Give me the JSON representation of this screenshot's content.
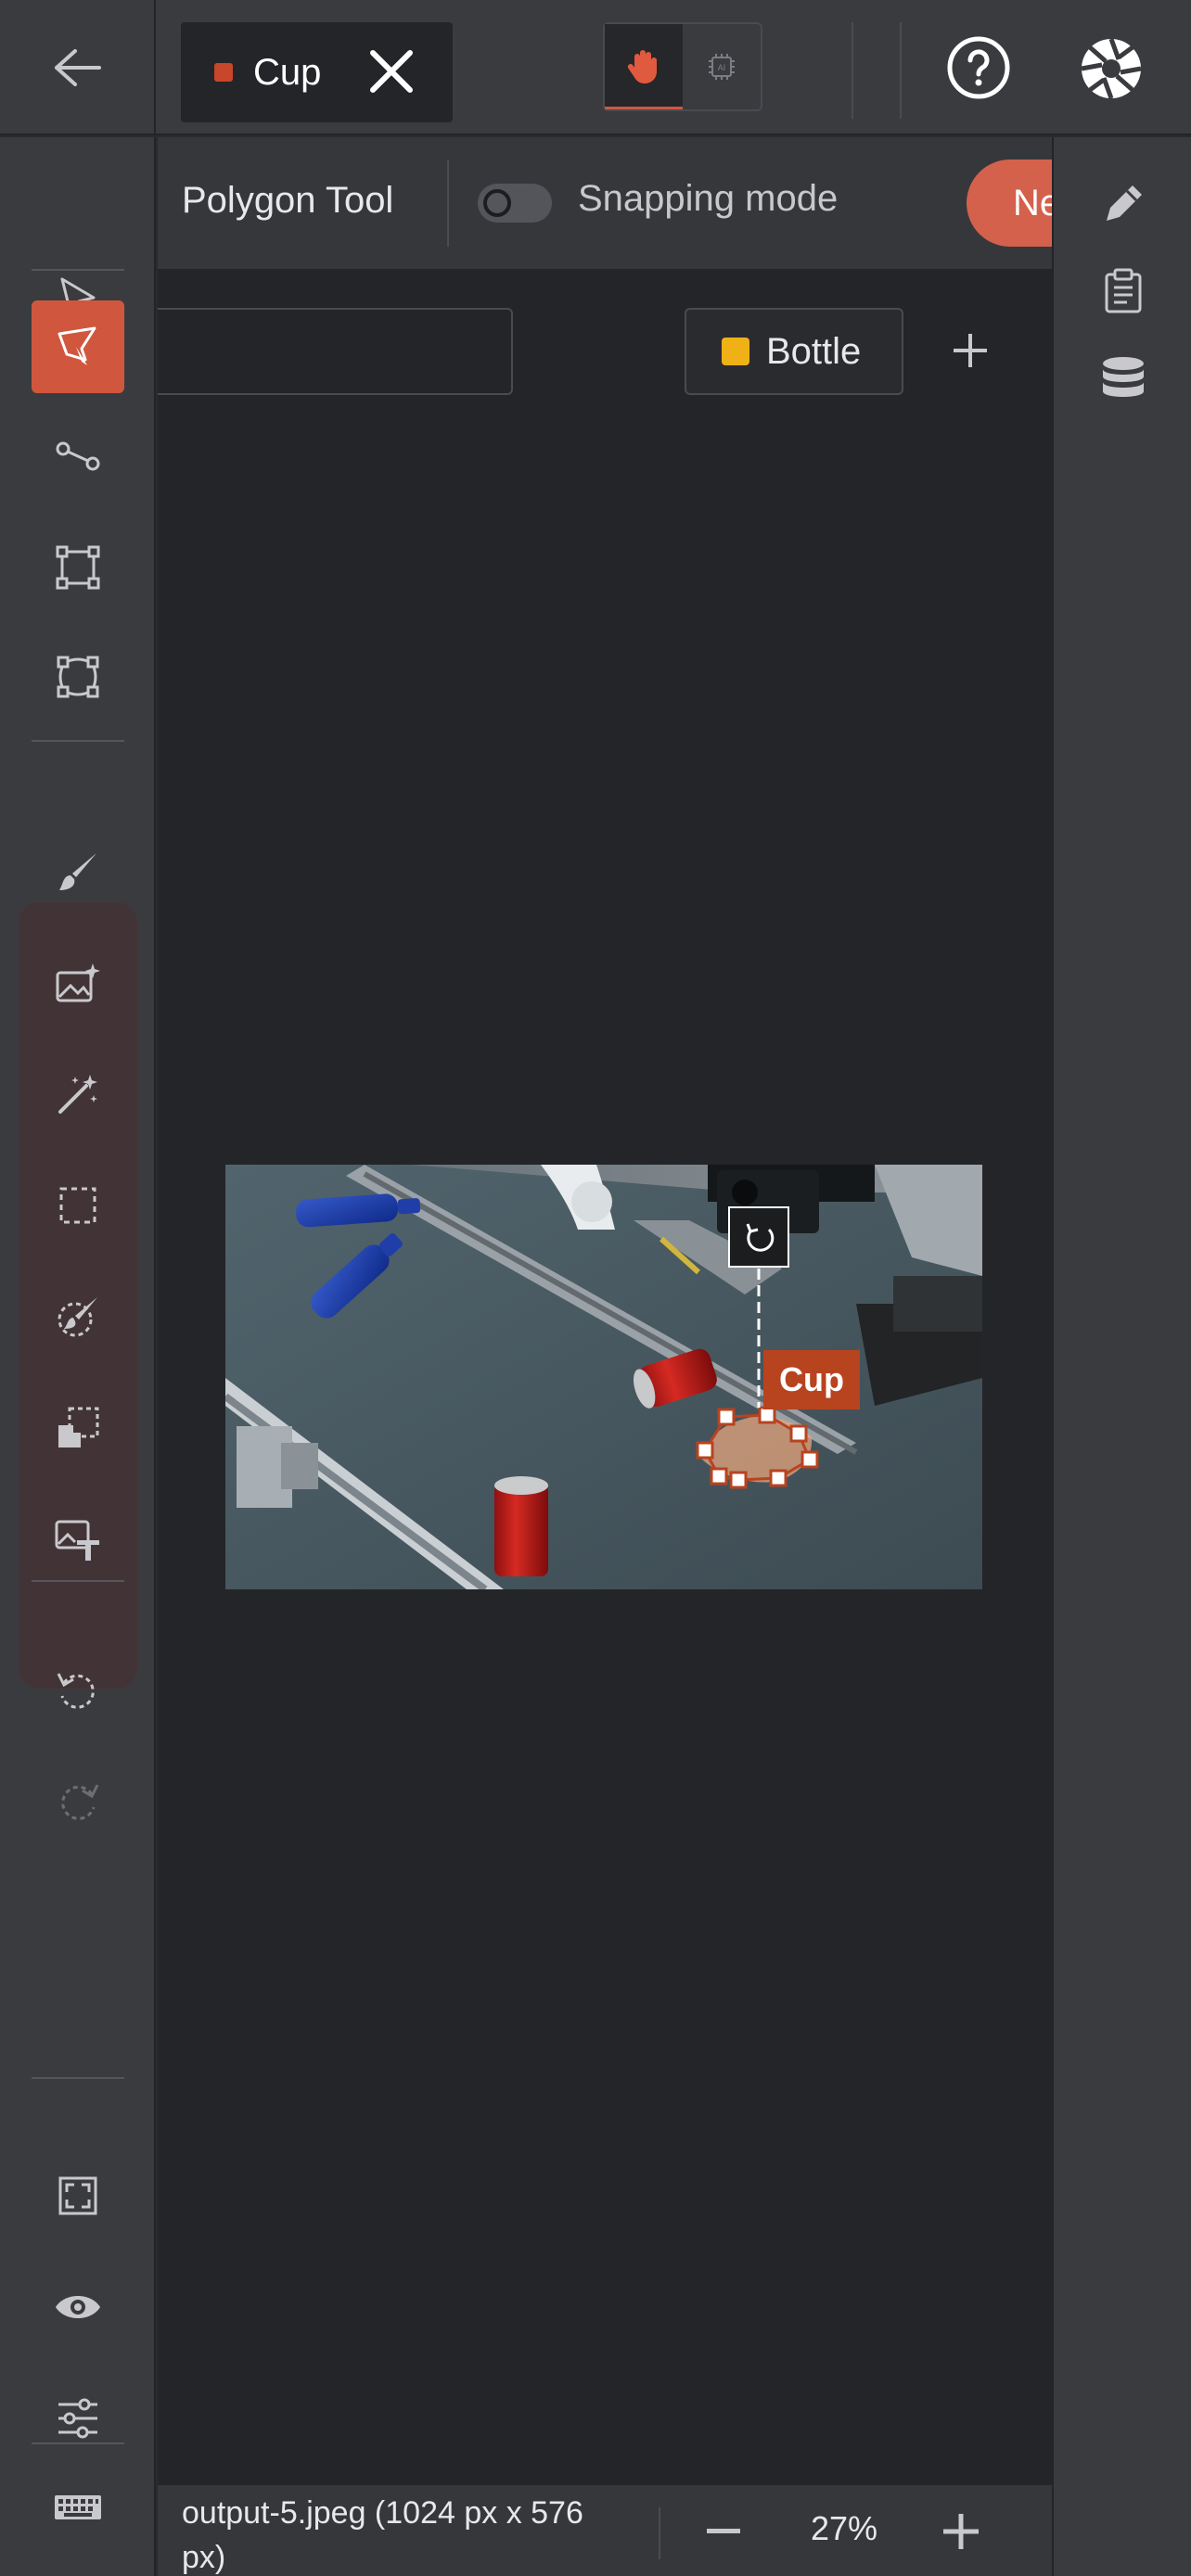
{
  "header": {
    "active_tab": {
      "label": "Cup",
      "color": "#c8462a"
    },
    "modes": [
      "hand-icon",
      "ai-chip-icon"
    ]
  },
  "options": {
    "tool_name": "Polygon Tool",
    "snapping_label": "Snapping mode",
    "snapping_on": false,
    "new_button_label": "Ne"
  },
  "labels": [
    {
      "name": "Bottle",
      "color": "#f0b116"
    }
  ],
  "annotation": {
    "label": "Cup",
    "color": "#b8431f"
  },
  "left_tools": [
    "select-arrow-icon",
    "polygon-tool-icon",
    "line-tool-icon",
    "bounding-box-icon",
    "rotated-box-icon",
    "brush-icon",
    "smart-image-icon",
    "magic-wand-icon",
    "rectangle-select-icon",
    "eraser-brush-icon",
    "copy-region-icon",
    "image-text-icon",
    "undo-icon",
    "redo-icon",
    "fit-screen-icon",
    "visibility-icon",
    "adjust-icon",
    "keyboard-icon"
  ],
  "right_tools": [
    "pencil-icon",
    "clipboard-icon",
    "database-icon"
  ],
  "status": {
    "file_info": "output-5.jpeg (1024 px x 576 px)",
    "zoom": "27%"
  }
}
